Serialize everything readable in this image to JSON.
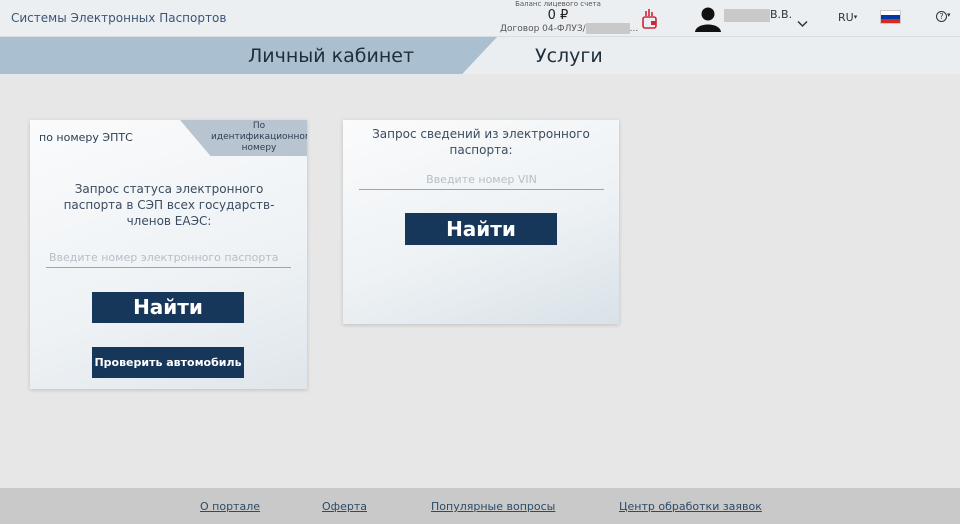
{
  "header": {
    "brand": "Системы Электронных Паспортов",
    "balance_label": "Баланс лицевого счета",
    "balance_amount": "0 ₽",
    "contract_prefix": "Договор 04-ФЛУЗ/",
    "contract_suffix": "...",
    "user_initials": "В.В.",
    "language": "RU",
    "help": "?"
  },
  "tabs": {
    "cabinet": "Личный кабинет",
    "services": "Услуги"
  },
  "card_epts": {
    "tab_by_number": "по номеру ЭПТС",
    "tab_by_id": "По идентификационному номеру",
    "question": "Запрос статуса электронного паспорта в СЭП всех государств-членов ЕАЭС:",
    "placeholder": "Введите номер электронного паспорта",
    "find_button": "Найти",
    "check_car_button": "Проверить автомобиль"
  },
  "card_vin": {
    "question": "Запрос сведений из электронного паспорта:",
    "placeholder": "Введите номер VIN",
    "find_button": "Найти"
  },
  "footer": {
    "links": [
      "О портале",
      "Оферта",
      "Популярные вопросы",
      "Центр обработки заявок"
    ]
  },
  "colors": {
    "accent": "#17375a",
    "tab_active": "#aabfcf",
    "footer_bg": "#c9c9c9"
  },
  "icons": {
    "wallet": "wallet-icon",
    "avatar": "user-avatar-icon",
    "chevron": "chevron-down-icon",
    "flag": "russia-flag-icon"
  }
}
